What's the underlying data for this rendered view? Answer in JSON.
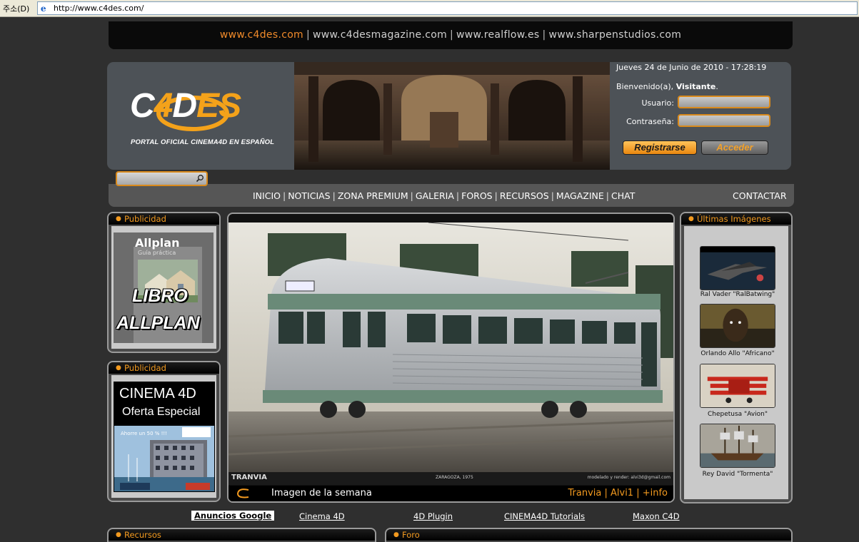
{
  "browser": {
    "address_label": "주소(D)",
    "url": "http://www.c4des.com/"
  },
  "topbar": {
    "links": [
      "www.c4des.com",
      "www.c4desmagazine.com",
      "www.realflow.es",
      "www.sharpenstudios.com"
    ]
  },
  "header": {
    "logo_main": "C",
    "logo_four": "4",
    "logo_d": "D",
    "logo_es": "ES",
    "subtitle": "PORTAL OFICIAL CINEMA4D EN ESPAÑOL",
    "date": "Jueves 24 de Junio de 2010 - 17:28:19",
    "welcome_prefix": "Bienvenido(a), ",
    "welcome_user": "Visitante",
    "welcome_suffix": ".",
    "user_label": "Usuario:",
    "pass_label": "Contraseña:",
    "register": "Registrarse",
    "login": "Acceder"
  },
  "nav": {
    "items": [
      "INICIO",
      "NOTICIAS",
      "ZONA PREMIUM",
      "GALERIA",
      "FOROS",
      "RECURSOS",
      "MAGAZINE",
      "CHAT"
    ],
    "contact": "CONTACTAR"
  },
  "left": {
    "box1_title": "Publicidad",
    "allplan_brand": "Allplan",
    "allplan_guide": "Guía práctica",
    "allplan_big1": "LIBRO",
    "allplan_big2": "ALLPLAN",
    "box2_title": "Publicidad",
    "c4d_title": "CINEMA 4D",
    "c4d_offer": "Oferta Especial",
    "c4d_small": "Ahorre un 50 % !!!"
  },
  "feature": {
    "caption_left": "TRANVIA",
    "caption_mid": "ZARAGOZA, 1975",
    "caption_right": "modelado y render: alvi3d@gmail.com",
    "label": "Imagen de la semana",
    "links": "Tranvia | Alvi1 | +info"
  },
  "right": {
    "title": "Últimas Imágenes",
    "thumbs": [
      {
        "caption": "Ral Vader \"RalBatwing\""
      },
      {
        "caption": "Orlando Allo \"Africano\""
      },
      {
        "caption": "Chepetusa \"Avion\""
      },
      {
        "caption": "Rey David \"Tormenta\""
      }
    ]
  },
  "google": {
    "ads": "Anuncios Google",
    "links": [
      "Cinema 4D",
      "4D Plugin",
      "CINEMA4D Tutorials",
      "Maxon C4D"
    ]
  },
  "bottom": {
    "recursos": "Recursos",
    "foro": "Foro"
  },
  "colors": {
    "accent": "#f39a1f",
    "bg": "#2f2f2f",
    "panel": "#4b4b4b"
  }
}
